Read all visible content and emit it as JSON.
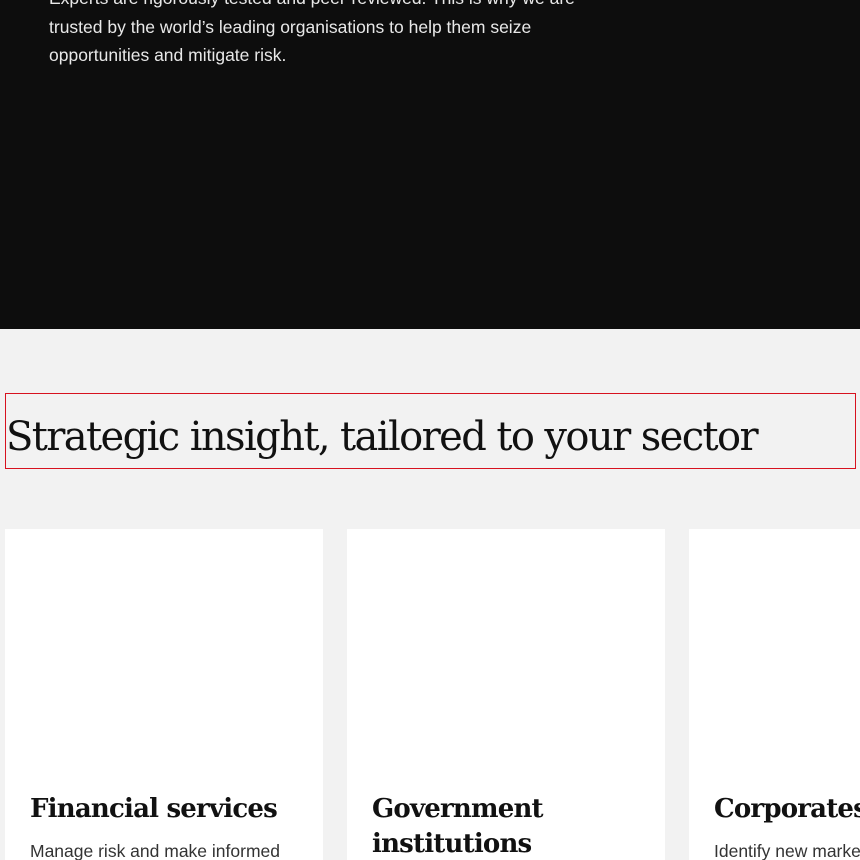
{
  "hero": {
    "body_lines": [
      "Experts are rigorously tested and peer-reviewed. This is why we are",
      "trusted by the world’s leading organisations to help them seize",
      "opportunities and mitigate risk."
    ]
  },
  "sectors": {
    "heading": "Strategic insight, tailored to your sector",
    "cards": [
      {
        "title": "Financial services",
        "description": "Manage risk and make informed"
      },
      {
        "title": "Government institutions",
        "description": ""
      },
      {
        "title": "Corporates",
        "description": "Identify new markets"
      }
    ]
  }
}
